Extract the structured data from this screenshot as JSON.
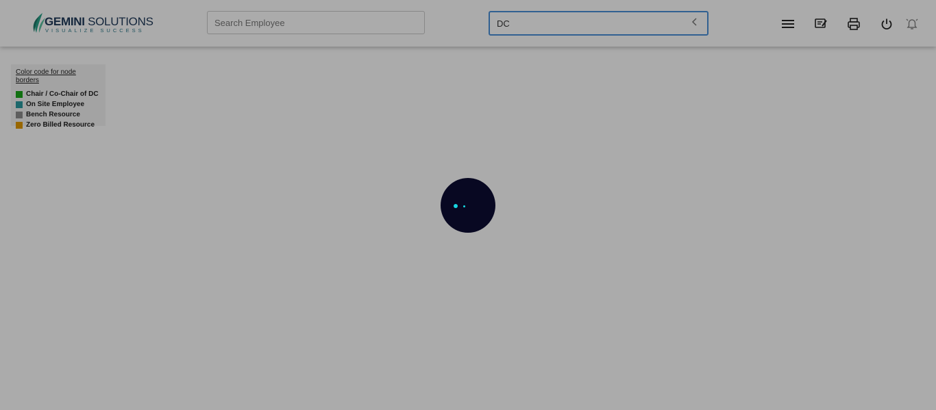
{
  "brand": {
    "name_bold": "GEMINI",
    "name_rest": " SOLUTIONS",
    "tagline": "VISUALIZE SUCCESS",
    "colors": {
      "primary": "#1f3a5a",
      "accent": "#2c7a8a"
    }
  },
  "search": {
    "placeholder": "Search Employee",
    "value": ""
  },
  "filter": {
    "value": "DC",
    "icon": "chevron-left-icon"
  },
  "toolbar": {
    "icons": [
      "menu-icon",
      "edit-note-icon",
      "print-icon",
      "power-icon",
      "notification-off-icon"
    ]
  },
  "legend": {
    "title": "Color code for node borders",
    "items": [
      {
        "label": "Chair / Co-Chair of DC",
        "color": "#1aa81a"
      },
      {
        "label": "On Site Employee",
        "color": "#2b9aa0"
      },
      {
        "label": "Bench Resource",
        "color": "#8c8c8c"
      },
      {
        "label": "Zero Billed Resource",
        "color": "#e39a00"
      }
    ]
  },
  "loading": {
    "colors": {
      "spinner_bg": "#080822",
      "dots": "#17d6e0"
    }
  }
}
